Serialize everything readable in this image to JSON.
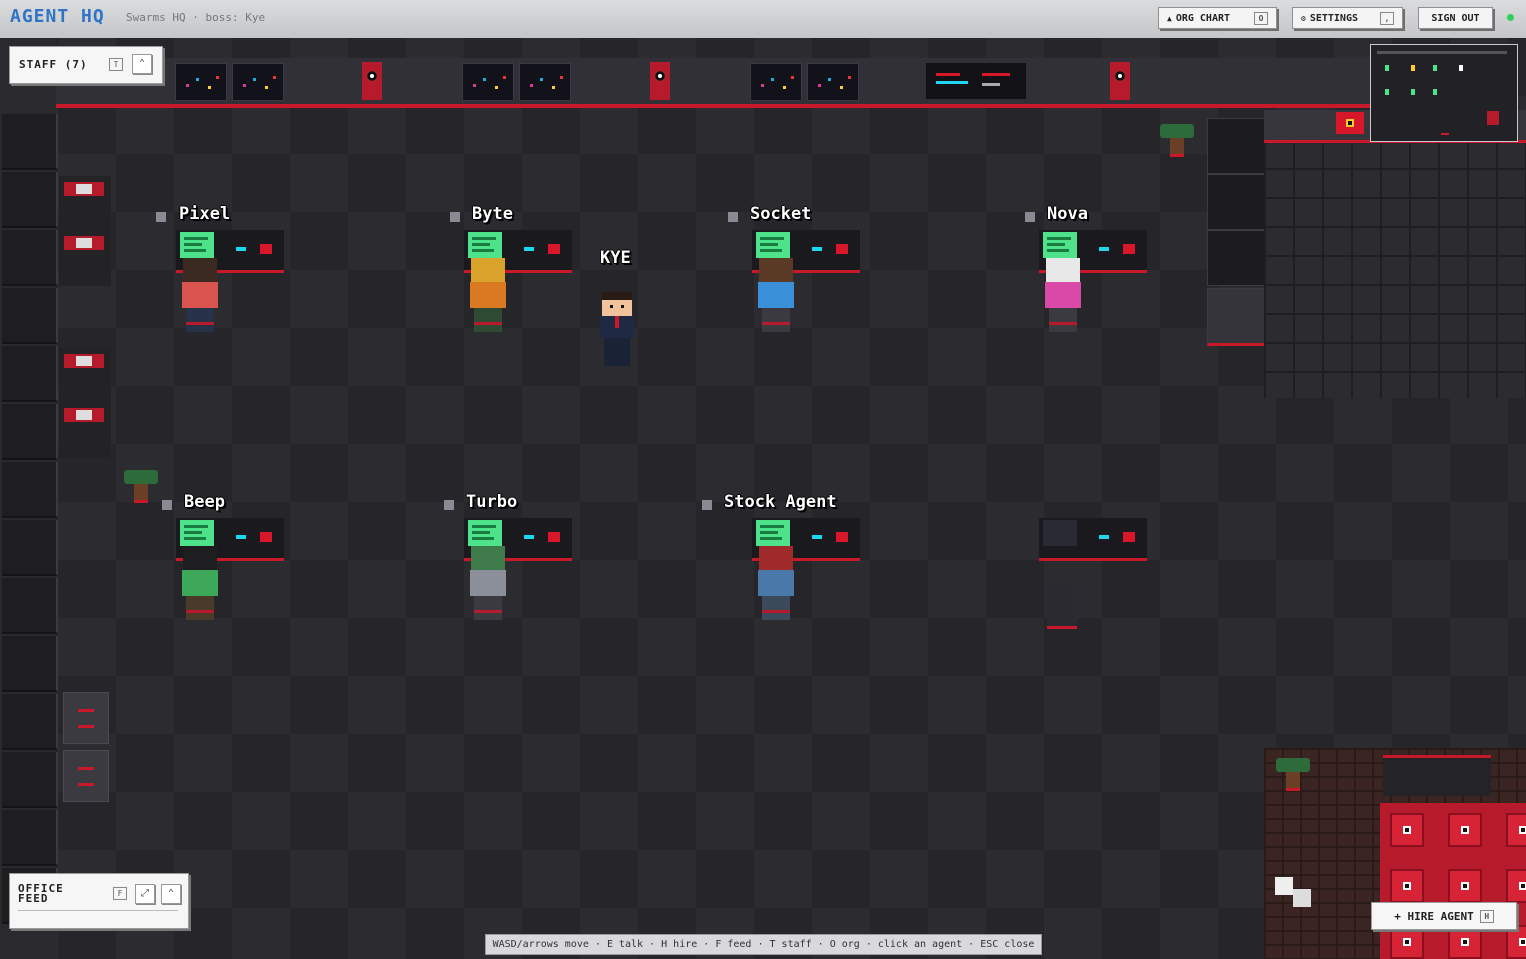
{
  "topbar": {
    "title": "AGENT HQ",
    "subtitle": "Swarms HQ · boss: Kye",
    "org_chart": {
      "label": "ORG CHART",
      "key": "O",
      "icon": "up-arrow-icon"
    },
    "settings": {
      "label": "SETTINGS",
      "key": ",",
      "icon": "gear-icon"
    },
    "sign_out": {
      "label": "SIGN OUT"
    },
    "status_color": "#2fd05a"
  },
  "staff_panel": {
    "title": "STAFF (7)",
    "key": "T",
    "collapse_icon": "chevron-up-icon"
  },
  "feed_panel": {
    "title": "OFFICE FEED",
    "key": "F",
    "expand_icon": "expand-icon",
    "collapse_icon": "chevron-up-icon"
  },
  "boss": {
    "name": "KYE"
  },
  "agents": [
    {
      "name": "Pixel",
      "shirt": "#d9534f",
      "hair": "#3a2a22"
    },
    {
      "name": "Byte",
      "shirt": "#d97a22",
      "hair": "#d9a22a"
    },
    {
      "name": "Socket",
      "shirt": "#3a8fd9",
      "hair": "#5a3a25"
    },
    {
      "name": "Nova",
      "shirt": "#d94aa8",
      "hair": "#e8e8e8"
    },
    {
      "name": "Beep",
      "shirt": "#3ea85a",
      "hair": "#1e1e20"
    },
    {
      "name": "Turbo",
      "shirt": "#8a8f99",
      "hair": "#3e7a4a"
    },
    {
      "name": "Stock Agent",
      "shirt": "#4a78a8",
      "hair": "#a02a2a"
    }
  ],
  "hire_button": {
    "label": "+ HIRE AGENT",
    "key": "H"
  },
  "help_bar": "WASD/arrows move · E talk · H hire · F feed · T staff · O org · click an agent · ESC close",
  "accent_color": "#c8182a"
}
